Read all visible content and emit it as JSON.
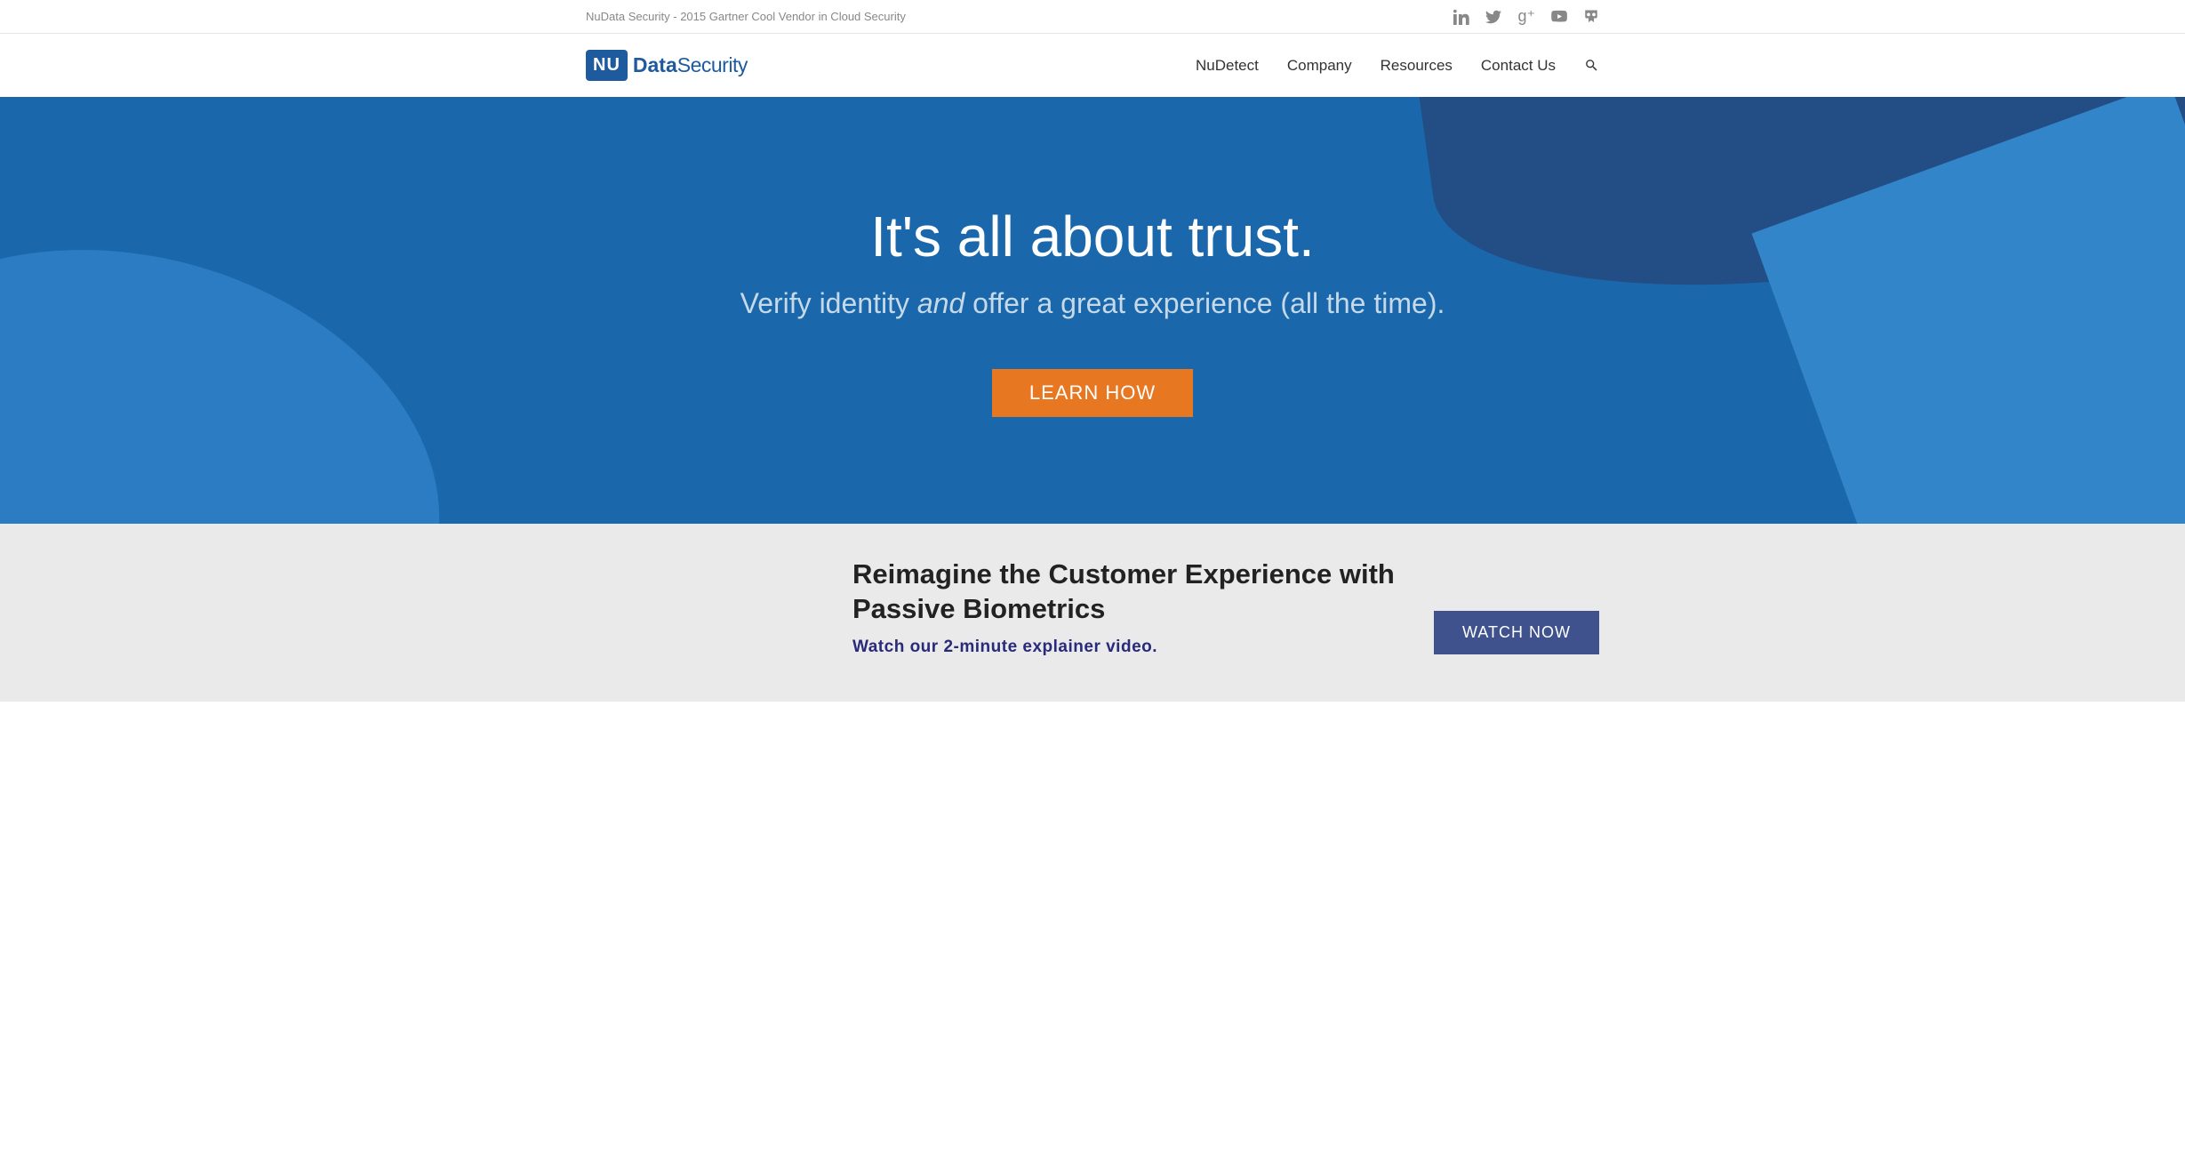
{
  "topbar": {
    "tagline": "NuData Security - 2015 Gartner Cool Vendor in Cloud Security"
  },
  "logo": {
    "box": "NU",
    "text_bold": "Data",
    "text_light": "Security"
  },
  "nav": {
    "items": [
      "NuDetect",
      "Company",
      "Resources",
      "Contact Us"
    ]
  },
  "hero": {
    "title": "It's all about trust.",
    "subtitle_pre": "Verify identity ",
    "subtitle_em": "and",
    "subtitle_post": " offer a great experience (all the time).",
    "cta": "LEARN HOW"
  },
  "section": {
    "title": "Reimagine the Customer Experience with Passive Biometrics",
    "sub": "Watch our 2-minute explainer video.",
    "cta": "WATCH NOW"
  }
}
